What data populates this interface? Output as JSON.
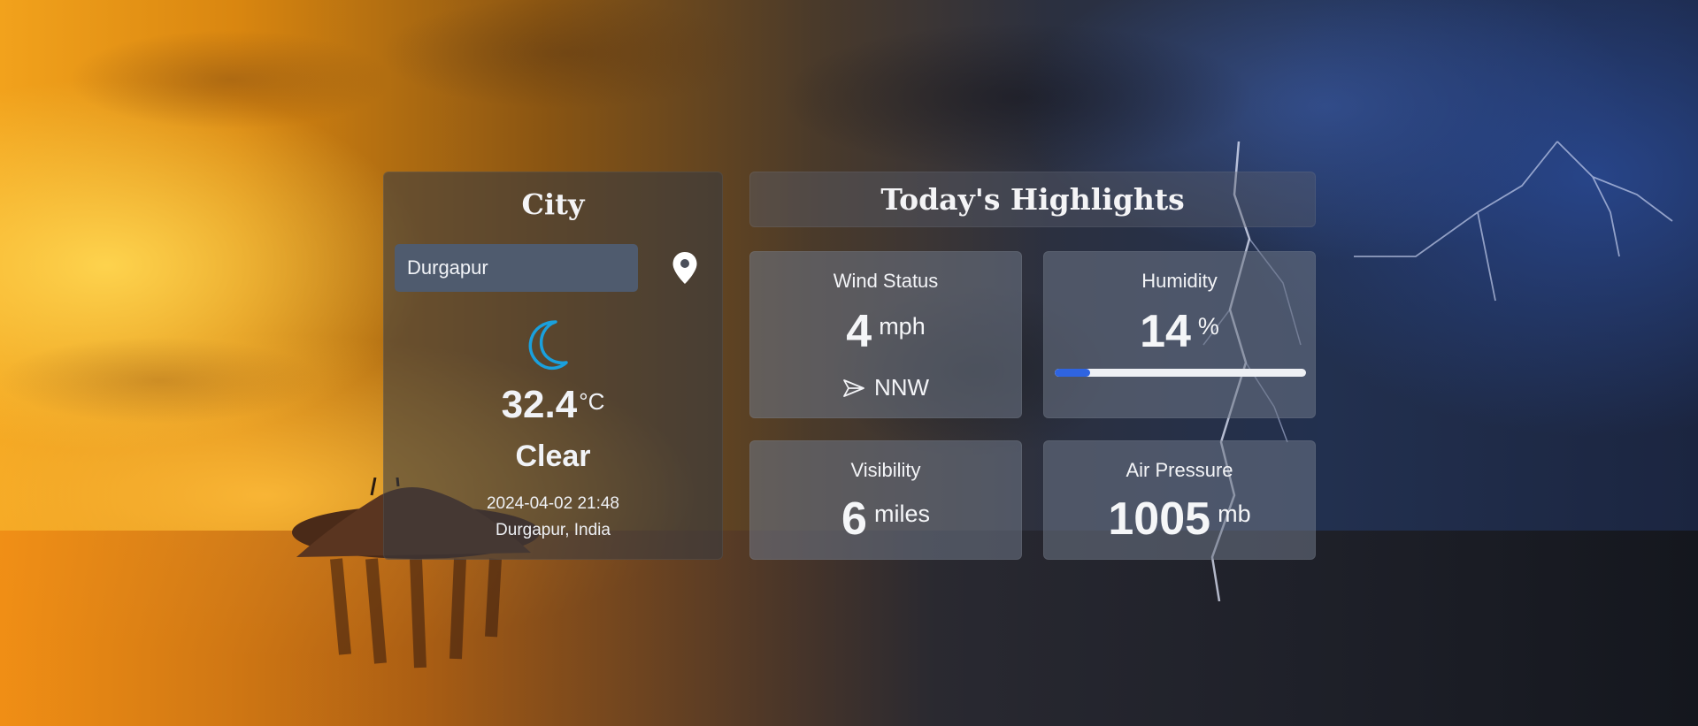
{
  "city_panel": {
    "title": "City",
    "search_value": "Durgapur",
    "location_icon": "map-pin-icon",
    "weather_icon": "crescent-moon-icon",
    "weather_icon_color": "#1aa0dd",
    "temperature": "32.4",
    "temperature_unit": "°C",
    "condition": "Clear",
    "datetime": "2024-04-02 21:48",
    "location": "Durgapur, India"
  },
  "highlights": {
    "title": "Today's Highlights",
    "wind": {
      "title": "Wind Status",
      "value": "4",
      "unit": "mph",
      "direction": "NNW",
      "direction_icon": "navigation-arrow-icon"
    },
    "humidity": {
      "title": "Humidity",
      "value": "14",
      "unit": "%",
      "percent": 14,
      "bar_color": "#2f64e0"
    },
    "visibility": {
      "title": "Visibility",
      "value": "6",
      "unit": "miles"
    },
    "air_pressure": {
      "title": "Air Pressure",
      "value": "1005",
      "unit": "mb"
    }
  }
}
